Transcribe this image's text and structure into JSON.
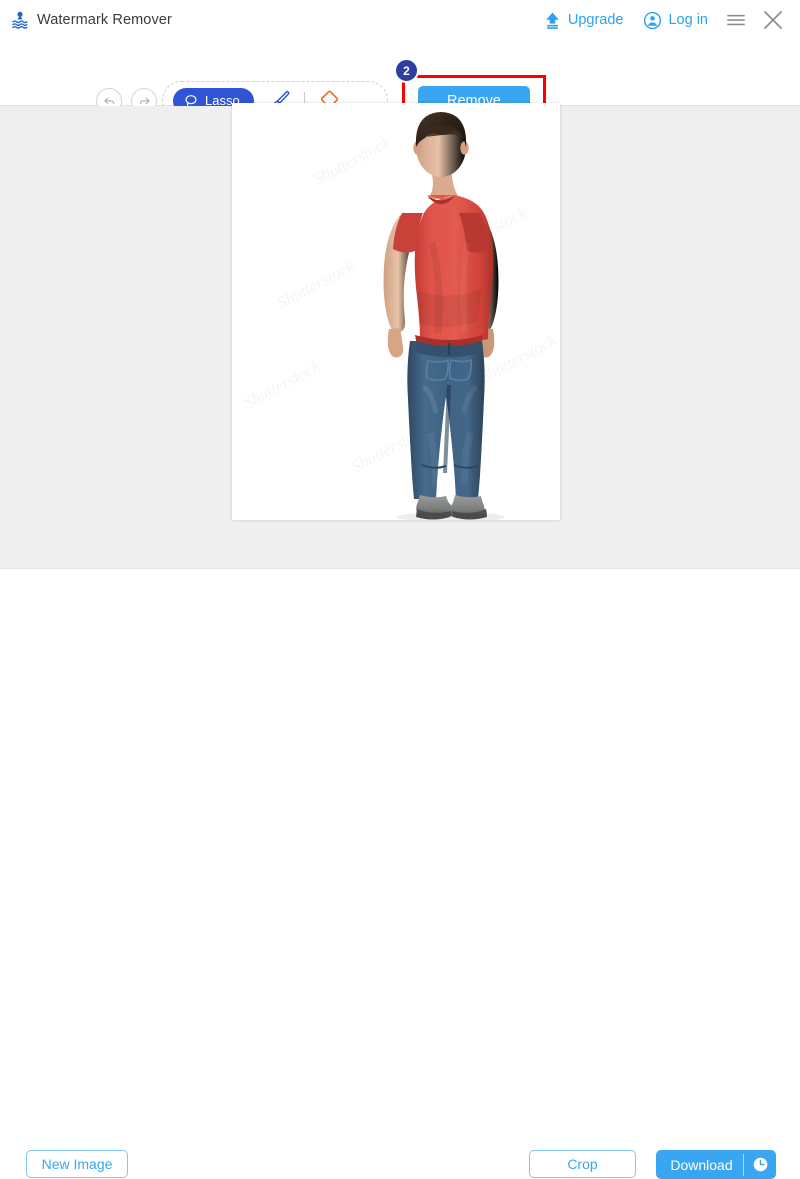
{
  "app": {
    "title": "Watermark Remover",
    "logo_icon": "watermark-logo-icon"
  },
  "titlebar": {
    "upgrade_label": "Upgrade",
    "upgrade_icon": "upload-arrow-icon",
    "login_label": "Log in",
    "login_icon": "user-circle-icon",
    "menu_icon": "hamburger-menu-icon",
    "close_icon": "close-icon"
  },
  "toolbar": {
    "undo_icon": "undo-arrow-icon",
    "redo_icon": "redo-arrow-icon",
    "lasso_label": "Lasso",
    "lasso_icon": "lasso-icon",
    "brush_icon": "paintbrush-icon",
    "eraser_icon": "eraser-icon",
    "remove_label": "Remove",
    "step_badge": "2"
  },
  "canvas": {
    "watermarks": [
      "Shutterstock",
      "Shutterstock",
      "Shutterstock",
      "Shutterstock",
      "Shutterstock",
      "Shutterstock"
    ]
  },
  "bottombar": {
    "new_image_label": "New Image",
    "crop_label": "Crop",
    "download_label": "Download",
    "download_icon": "clock-icon"
  },
  "colors": {
    "accent": "#3aa5f0",
    "lasso_active": "#2f55d4",
    "highlight": "#ff0000",
    "badge": "#2f3fa0",
    "eraser": "#f26522",
    "workspace_bg": "#efefef"
  }
}
